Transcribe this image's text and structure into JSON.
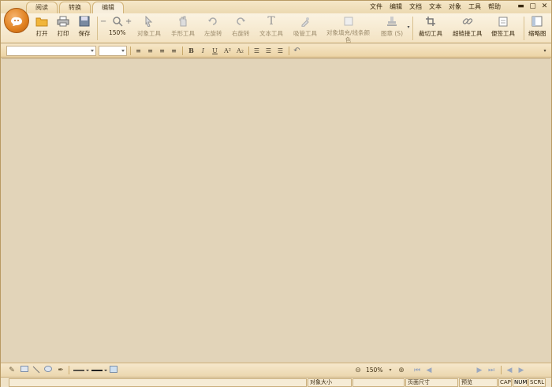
{
  "tabs": [
    "阅读",
    "转换",
    "编辑"
  ],
  "menu": [
    "文件",
    "编辑",
    "文档",
    "文本",
    "对象",
    "工具",
    "帮助"
  ],
  "window_buttons": [
    "▬",
    "▢",
    "✕"
  ],
  "ribbon": {
    "open": "打开",
    "print": "打印",
    "save": "保存",
    "zoom_value": "150%",
    "object_tool": "对象工具",
    "hand_tool": "手形工具",
    "rotate_left": "左旋转",
    "rotate_right": "右旋转",
    "text_tool": "文本工具",
    "eyedropper": "吸管工具",
    "fill_line_1": "对象填充/线条颜",
    "fill_line_2": "色",
    "stamp": "图章 (S)",
    "crop": "裁切工具",
    "hyperlink": "超链接工具",
    "note": "便签工具",
    "thumbnail": "缩略图"
  },
  "format": {
    "bold": "B",
    "italic": "I",
    "underline": "U",
    "superscript": "A²",
    "subscript": "A₂"
  },
  "bottom": {
    "zoom": "150%"
  },
  "status": {
    "object_size": "对象大小",
    "page_size": "页面尺寸",
    "preview": "预览",
    "cap": "CAP",
    "num": "NUM",
    "scrl": "SCRL"
  }
}
